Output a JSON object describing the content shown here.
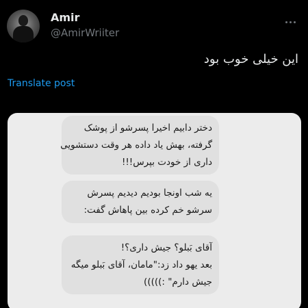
{
  "header": {
    "display_name": "Amir",
    "handle": "@AmirWriiter"
  },
  "tweet": {
    "text": "این خیلی خوب بود",
    "translate_label": "Translate post"
  },
  "media": {
    "bubbles": [
      {
        "lines": [
          "دختر دابیم اخیرا پسرشو از پوشک",
          "گرفته، بهش یاد داده هر وقت دستشویی",
          "داری از خودت بپرس!!!"
        ]
      },
      {
        "lines": [
          "یه شب اونجا بودیم دیدیم پسرش",
          "سرشو خم کرده بین پاهاش گفت:"
        ]
      },
      {
        "lines": [
          "آقای بَبلو؟ جیش داری؟!",
          "بعد یهو داد زد:\"مامان، آقای بَبلو میگه",
          "جیش دارم\" :)))))"
        ]
      }
    ]
  },
  "icons": {
    "more": "more-horizontal-icon",
    "avatar": "avatar"
  },
  "colors": {
    "background": "#000000",
    "text": "#e7e9ea",
    "secondary": "#71767b",
    "link": "#1d9bf0",
    "media_bg": "#ececec",
    "bubble_bg": "#e0e0e0"
  }
}
